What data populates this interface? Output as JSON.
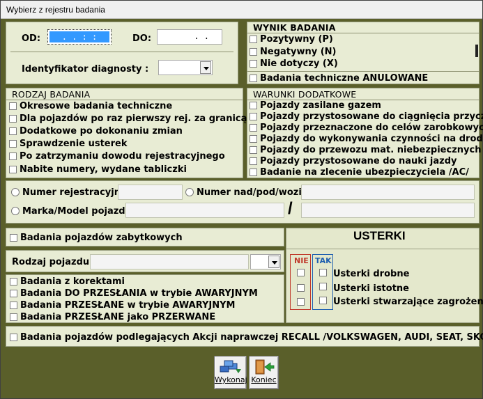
{
  "window": {
    "title": "Wybierz z rejestru badania"
  },
  "dates": {
    "od_label": "OD:",
    "od_value": " .  .     :  :",
    "do_label": "DO:",
    "do_value": ".  ."
  },
  "diagnosta": {
    "label": "Identyfikator diagnosty :"
  },
  "wynik": {
    "header": "WYNIK BADANIA",
    "items": [
      "Pozytywny  (P)",
      "Negatywny  (N)",
      "Nie dotyczy  (X)"
    ],
    "anulowane": "Badania techniczne ANULOWANE"
  },
  "rodzaj": {
    "header": "RODZAJ BADANIA",
    "items": [
      "Okresowe badania techniczne",
      "Dla pojazdów po raz pierwszy rej. za granicą",
      "Dodatkowe po dokonaniu zmian",
      "Sprawdzenie usterek",
      "Po zatrzymaniu dowodu rejestracyjnego",
      "Nabite numery, wydane tabliczki"
    ]
  },
  "warunki": {
    "header": "WARUNKI DODATKOWE",
    "items": [
      "Pojazdy zasilane gazem",
      "Pojazdy przystosowane do ciągnięcia przyczepy",
      "Pojazdy przeznaczone do celów zarobkowych",
      "Pojazdy do wykonywania czynności na drodze",
      "Pojazdy do przewozu mat. niebezpiecznych",
      "Pojazdy przystosowane do nauki jazdy",
      "Badanie na zlecenie ubezpieczyciela /AC/"
    ]
  },
  "search": {
    "numer_rej": "Numer rejestracyjny :",
    "numer_nad": "Numer nad/pod/wozia :",
    "marka": "Marka/Model pojazdu :",
    "slash": "/"
  },
  "zabytkowe": {
    "label": "Badania pojazdów zabytkowych"
  },
  "pojazd": {
    "label": "Rodzaj pojazdu :"
  },
  "inne": {
    "items": [
      "Badania z korektami",
      "Badania DO PRZESŁANIA w trybie AWARYJNYM",
      "Badania PRZESŁANE w trybie AWARYJNYM",
      "Badania PRZESŁANE jako PRZERWANE"
    ]
  },
  "usterki": {
    "title": "USTERKI",
    "nie": "NIE",
    "tak": "TAK",
    "items": [
      "Usterki drobne",
      "Usterki istotne",
      "Usterki stwarzające zagrożenie"
    ]
  },
  "recall": {
    "label": "Badania pojazdów podlegających Akcji naprawczej RECALL /VOLKSWAGEN, AUDI, SEAT, SKODA/"
  },
  "buttons": {
    "wykonaj": "Wykonaj",
    "koniec": "Koniec"
  },
  "colors": {
    "nie": "#c0392b",
    "tak": "#1f5fb0",
    "od_highlight": "#3399ff"
  }
}
